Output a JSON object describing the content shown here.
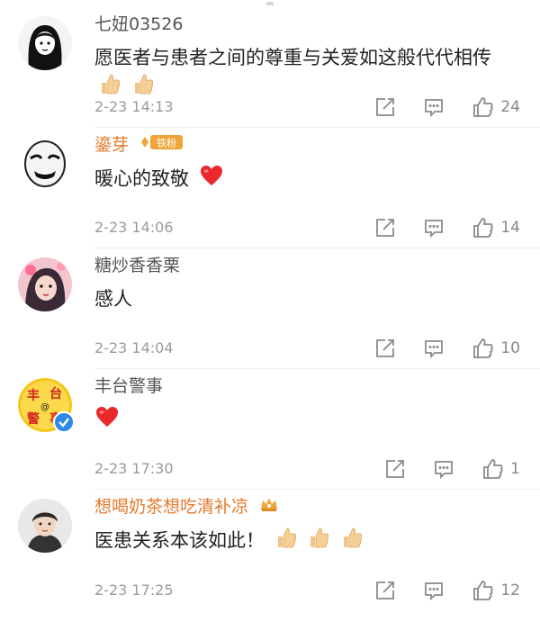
{
  "comments": [
    {
      "username": "七妞03526",
      "content": "愿医者与患者之间的尊重与关爱如这般代代相传",
      "timestamp": "2-23 14:13",
      "likes": "24",
      "emoji": [
        "thumbs-up",
        "thumbs-up"
      ]
    },
    {
      "username": "鎏芽",
      "badge": "铁粉",
      "content": "暖心的致敬",
      "timestamp": "2-23 14:06",
      "likes": "14",
      "emoji": [
        "red-heart"
      ]
    },
    {
      "username": "糖炒香香栗",
      "content": "感人",
      "timestamp": "2-23 14:04",
      "likes": "10"
    },
    {
      "username": "丰台警事",
      "avatar_text": [
        "丰",
        "台",
        "@",
        "警",
        "事"
      ],
      "content": "",
      "timestamp": "2-23 17:30",
      "likes": "1",
      "emoji": [
        "red-heart"
      ],
      "verified": true
    },
    {
      "username": "想喝奶茶想吃清补凉",
      "content": "医患关系本该如此！",
      "timestamp": "2-23 17:25",
      "likes": "12",
      "emoji": [
        "thumbs-up",
        "thumbs-up",
        "thumbs-up"
      ]
    }
  ],
  "colors": {
    "username_gray": "#555555",
    "username_vip": "#e57a2c",
    "meta": "#9a9a9a",
    "heart": "#e8282b",
    "verified": "#2f89e8",
    "badge": "#f0a53a"
  },
  "icons": {
    "repost": "repost-icon",
    "comment": "comment-icon",
    "like": "like-icon"
  }
}
